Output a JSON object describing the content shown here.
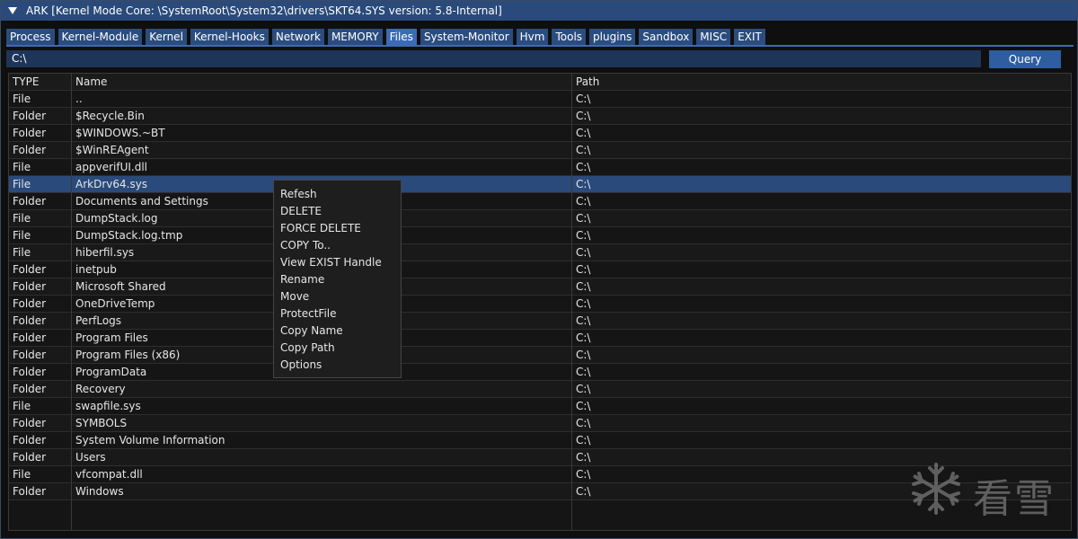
{
  "window": {
    "title": "ARK [Kernel Mode Core: \\SystemRoot\\System32\\drivers\\SKT64.SYS version: 5.8-Internal]",
    "accent_color": "#294a7a",
    "active_tab_color": "#3b6bb4"
  },
  "tabs": [
    {
      "label": "Process"
    },
    {
      "label": "Kernel-Module"
    },
    {
      "label": "Kernel"
    },
    {
      "label": "Kernel-Hooks"
    },
    {
      "label": "Network"
    },
    {
      "label": "MEMORY"
    },
    {
      "label": "Files"
    },
    {
      "label": "System-Monitor"
    },
    {
      "label": "Hvm"
    },
    {
      "label": "Tools"
    },
    {
      "label": "plugins"
    },
    {
      "label": "Sandbox"
    },
    {
      "label": "MISC"
    },
    {
      "label": "EXIT"
    }
  ],
  "active_tab": "Files",
  "path_input": {
    "value": "C:\\"
  },
  "query_button": {
    "label": "Query"
  },
  "table": {
    "columns": [
      "TYPE",
      "Name",
      "Path"
    ],
    "selected_name": "ArkDrv64.sys",
    "rows": [
      {
        "type": "File",
        "name": "..",
        "path": "C:\\"
      },
      {
        "type": "Folder",
        "name": "$Recycle.Bin",
        "path": "C:\\"
      },
      {
        "type": "Folder",
        "name": "$WINDOWS.~BT",
        "path": "C:\\"
      },
      {
        "type": "Folder",
        "name": "$WinREAgent",
        "path": "C:\\"
      },
      {
        "type": "File",
        "name": "appverifUI.dll",
        "path": "C:\\"
      },
      {
        "type": "File",
        "name": "ArkDrv64.sys",
        "path": "C:\\"
      },
      {
        "type": "Folder",
        "name": "Documents and Settings",
        "path": "C:\\"
      },
      {
        "type": "File",
        "name": "DumpStack.log",
        "path": "C:\\"
      },
      {
        "type": "File",
        "name": "DumpStack.log.tmp",
        "path": "C:\\"
      },
      {
        "type": "File",
        "name": "hiberfil.sys",
        "path": "C:\\"
      },
      {
        "type": "Folder",
        "name": "inetpub",
        "path": "C:\\"
      },
      {
        "type": "Folder",
        "name": "Microsoft Shared",
        "path": "C:\\"
      },
      {
        "type": "Folder",
        "name": "OneDriveTemp",
        "path": "C:\\"
      },
      {
        "type": "Folder",
        "name": "PerfLogs",
        "path": "C:\\"
      },
      {
        "type": "Folder",
        "name": "Program Files",
        "path": "C:\\"
      },
      {
        "type": "Folder",
        "name": "Program Files (x86)",
        "path": "C:\\"
      },
      {
        "type": "Folder",
        "name": "ProgramData",
        "path": "C:\\"
      },
      {
        "type": "Folder",
        "name": "Recovery",
        "path": "C:\\"
      },
      {
        "type": "File",
        "name": "swapfile.sys",
        "path": "C:\\"
      },
      {
        "type": "Folder",
        "name": "SYMBOLS",
        "path": "C:\\"
      },
      {
        "type": "Folder",
        "name": "System Volume Information",
        "path": "C:\\"
      },
      {
        "type": "Folder",
        "name": "Users",
        "path": "C:\\"
      },
      {
        "type": "File",
        "name": "vfcompat.dll",
        "path": "C:\\"
      },
      {
        "type": "Folder",
        "name": "Windows",
        "path": "C:\\"
      }
    ]
  },
  "context_menu": {
    "items": [
      {
        "label": "Refesh"
      },
      {
        "label": "DELETE"
      },
      {
        "label": "FORCE DELETE"
      },
      {
        "label": "COPY To.."
      },
      {
        "label": "View EXIST Handle"
      },
      {
        "label": "Rename"
      },
      {
        "label": "Move"
      },
      {
        "label": "ProtectFile"
      },
      {
        "label": "Copy Name"
      },
      {
        "label": "Copy Path"
      },
      {
        "label": "Options"
      }
    ]
  },
  "watermark": {
    "text": "看雪",
    "icon": "snowflake-icon"
  }
}
